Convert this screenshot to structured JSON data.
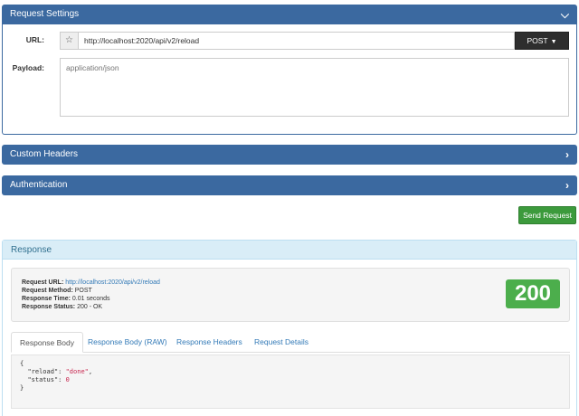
{
  "request_settings": {
    "title": "Request Settings",
    "url_label": "URL:",
    "url_value": "http://localhost:2020/api/v2/reload",
    "method": "POST",
    "payload_label": "Payload:",
    "payload_placeholder": "application/json"
  },
  "custom_headers": {
    "title": "Custom Headers"
  },
  "authentication": {
    "title": "Authentication"
  },
  "send_button": "Send Request",
  "response": {
    "title": "Response",
    "request_url_label": "Request URL:",
    "request_url": "http://localhost:2020/api/v2/reload",
    "request_method_label": "Request Method:",
    "request_method": "POST",
    "response_time_label": "Response Time:",
    "response_time": "0.01 seconds",
    "response_status_label": "Response Status:",
    "response_status": "200 - OK",
    "status_code": "200",
    "tabs": [
      "Response Body",
      "Response Body (RAW)",
      "Response Headers",
      "Request Details"
    ],
    "body": {
      "open": "{",
      "line1_key": "\"reload\"",
      "line1_value": "\"done\"",
      "line2_key": "\"status\"",
      "line2_value": "0",
      "close": "}"
    }
  },
  "colors": {
    "panel_header": "#3b69a0",
    "send_button": "#3c9a3c",
    "status_badge": "#4cae4c",
    "response_header_bg": "#d9edf7"
  },
  "icons": [
    "chevron-down-icon",
    "chevron-right-icon",
    "star-icon",
    "caret-down-icon"
  ]
}
